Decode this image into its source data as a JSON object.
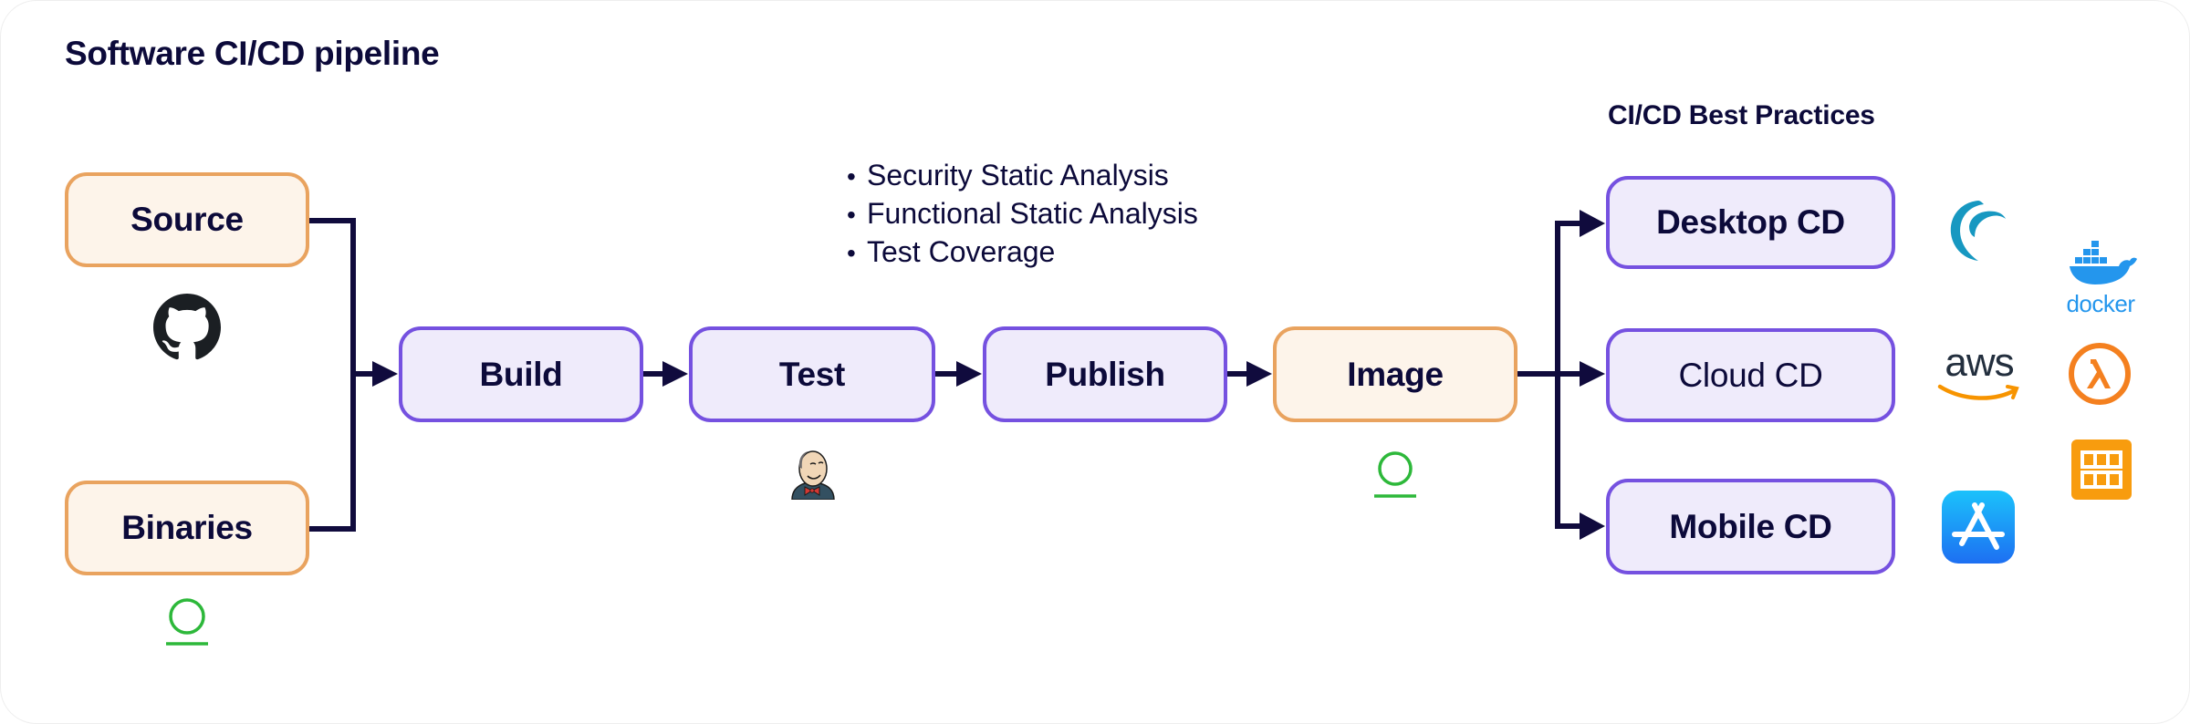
{
  "title": "Software CI/CD pipeline",
  "best_practices_label": "CI/CD Best Practices",
  "colors": {
    "text": "#0c0a3a",
    "connector": "#100b3d",
    "source_fill": "#fdf4ea",
    "source_border": "#e9a35f",
    "stage_fill": "#efebfb",
    "stage_border": "#7551e0",
    "status_green": "#2db83a"
  },
  "inputs": [
    {
      "id": "source",
      "label": "Source",
      "icon": "github-icon"
    },
    {
      "id": "binaries",
      "label": "Binaries",
      "icon": "status-ring-icon"
    }
  ],
  "stages": [
    {
      "id": "build",
      "label": "Build"
    },
    {
      "id": "test",
      "label": "Test",
      "icon": "jenkins-icon"
    },
    {
      "id": "publish",
      "label": "Publish"
    },
    {
      "id": "image",
      "label": "Image",
      "icon": "status-ring-icon"
    }
  ],
  "test_checks": [
    "Security Static Analysis",
    "Functional Static Analysis",
    "Test Coverage"
  ],
  "deployments": [
    {
      "id": "desktop",
      "label": "Desktop CD",
      "icons": [
        "wave-logo-icon",
        "docker-icon"
      ]
    },
    {
      "id": "cloud",
      "label": "Cloud CD",
      "icons": [
        "aws-icon",
        "lambda-icon",
        "grid-service-icon"
      ]
    },
    {
      "id": "mobile",
      "label": "Mobile CD",
      "icons": [
        "app-store-icon"
      ]
    }
  ],
  "logos": {
    "docker_text": "docker",
    "aws_text": "aws"
  }
}
